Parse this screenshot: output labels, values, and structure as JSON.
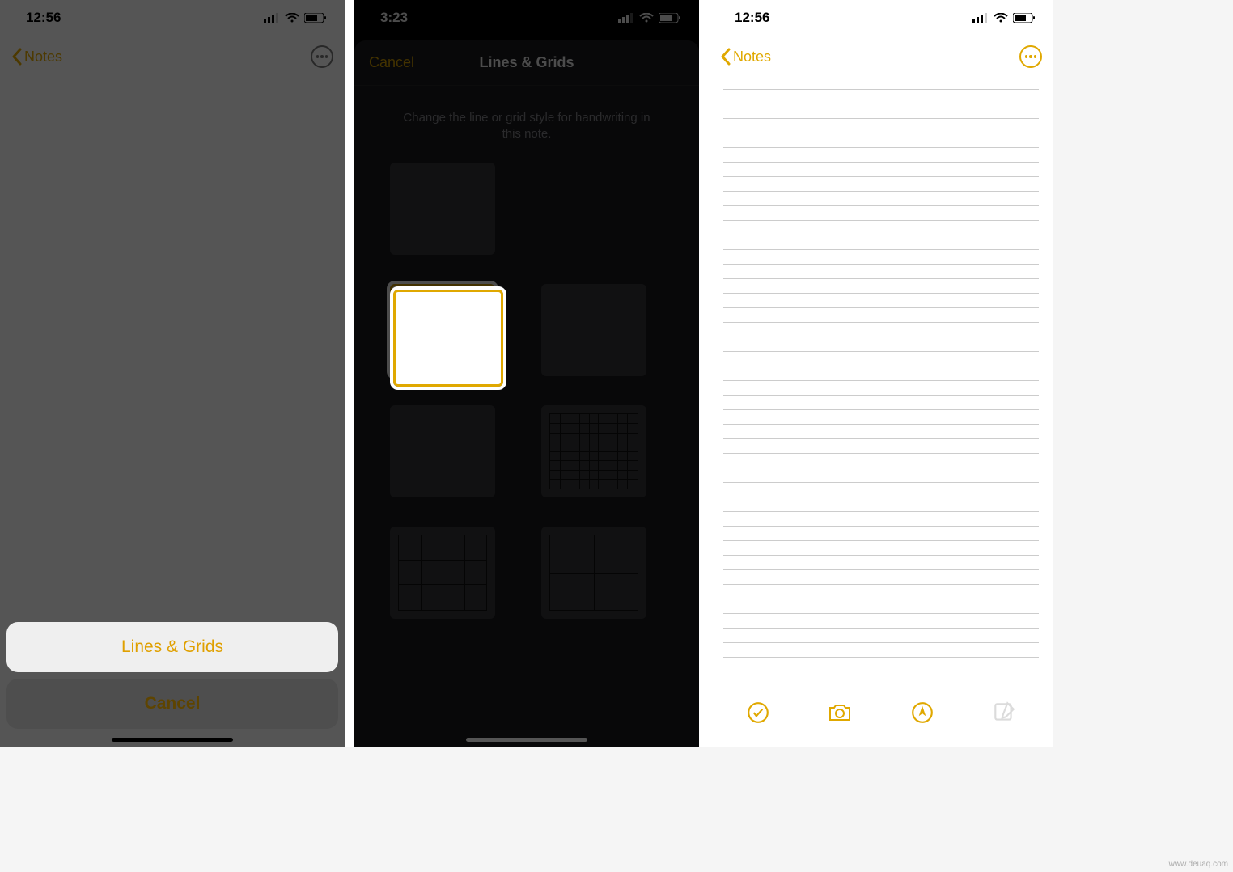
{
  "screens": {
    "s1": {
      "time": "12:56",
      "back_label": "Notes",
      "sheet_primary": "Lines & Grids",
      "sheet_cancel": "Cancel"
    },
    "s2": {
      "time": "3:23",
      "modal_cancel": "Cancel",
      "modal_title": "Lines & Grids",
      "modal_desc": "Change the line or grid style for handwriting in this note.",
      "options": [
        {
          "id": "blank",
          "selected": false
        },
        {
          "id": "lines-narrow",
          "selected": true
        },
        {
          "id": "lines-medium",
          "selected": false
        },
        {
          "id": "lines-wide",
          "selected": false
        },
        {
          "id": "grid-small",
          "selected": false
        },
        {
          "id": "grid-medium",
          "selected": false
        },
        {
          "id": "grid-large",
          "selected": false
        }
      ]
    },
    "s3": {
      "time": "12:56",
      "back_label": "Notes"
    }
  },
  "watermark": "www.deuaq.com",
  "colors": {
    "accent": "#e0a800"
  }
}
